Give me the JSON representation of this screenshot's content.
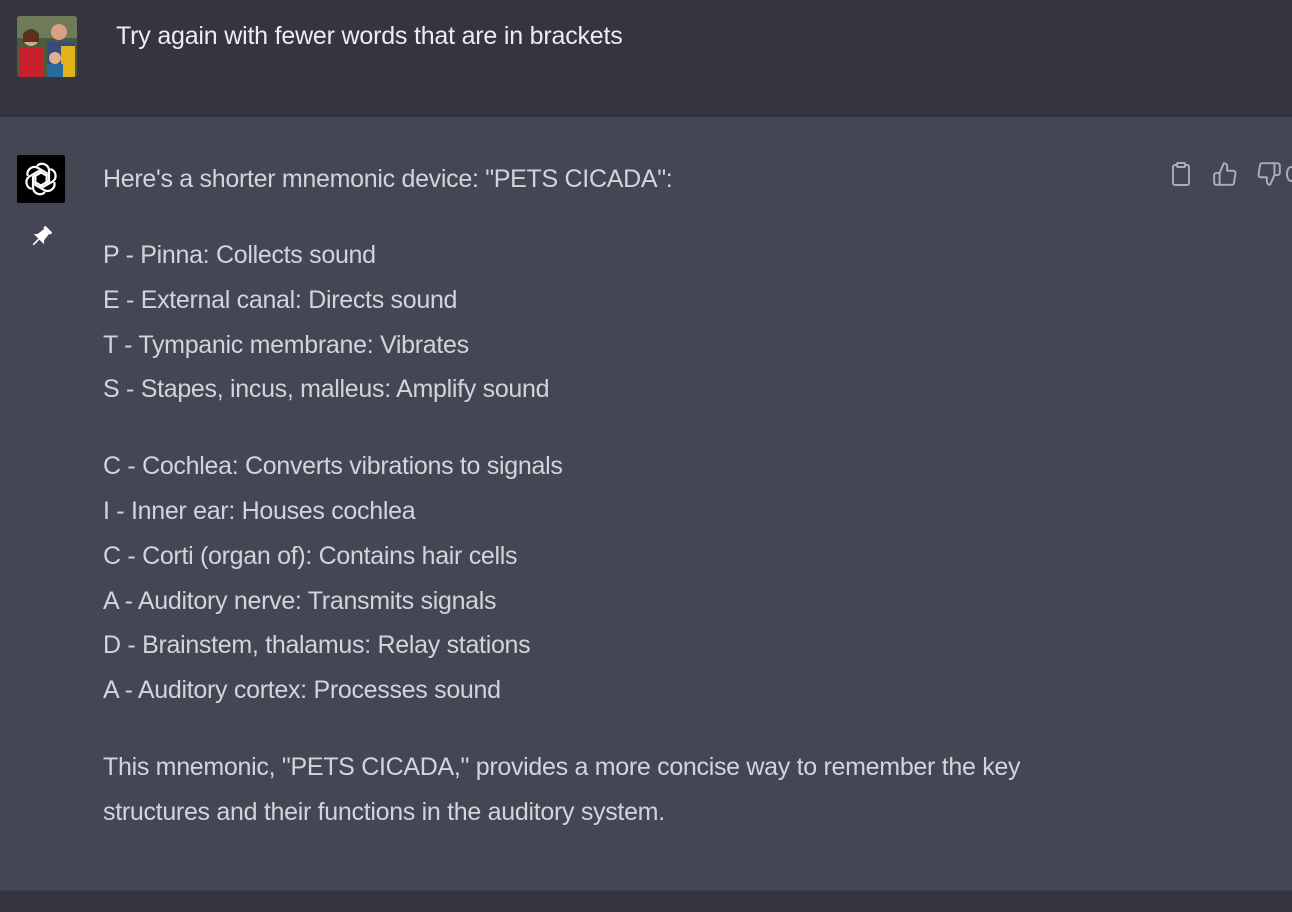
{
  "user": {
    "message": "Try again with fewer words that are in brackets"
  },
  "assistant": {
    "intro": "Here's a shorter mnemonic device: \"PETS CICADA\":",
    "group1": [
      "P - Pinna: Collects sound",
      "E - External canal: Directs sound",
      "T - Tympanic membrane: Vibrates",
      "S - Stapes, incus, malleus: Amplify sound"
    ],
    "group2": [
      "C - Cochlea: Converts vibrations to signals",
      "I - Inner ear: Houses cochlea",
      "C - Corti (organ of): Contains hair cells",
      "A - Auditory nerve: Transmits signals",
      "D - Brainstem, thalamus: Relay stations",
      "A - Auditory cortex: Processes sound"
    ],
    "outro": [
      "This mnemonic, \"PETS CICADA,\" provides a more concise way to remember the key",
      "structures and their functions in the auditory system."
    ]
  },
  "actions": {
    "icons": [
      "clipboard-icon",
      "thumbs-up-icon",
      "thumbs-down-icon"
    ]
  },
  "colors": {
    "user_bg": "#343541",
    "assistant_bg": "#444654",
    "text": "#d1d5db",
    "icon": "#acacbe"
  }
}
